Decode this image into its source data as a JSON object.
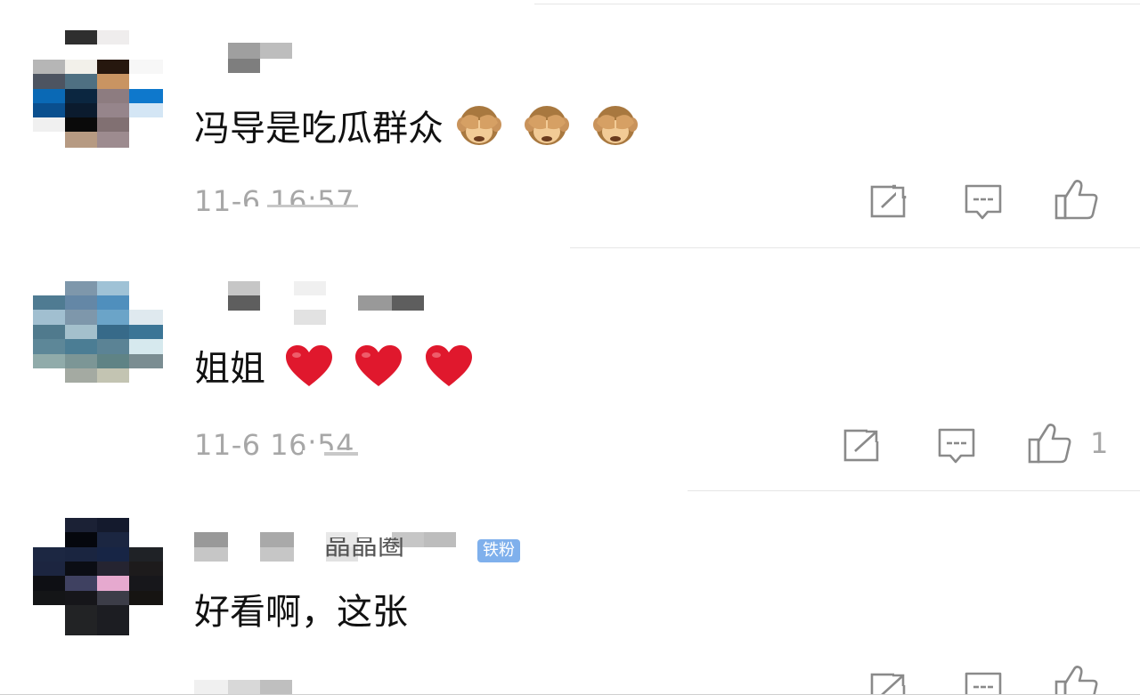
{
  "colors": {
    "text": "#111111",
    "meta": "#a7a7a7",
    "divider": "#e6e6e6",
    "badge": "#7fb0ec",
    "heart": "#e0182d"
  },
  "comments": [
    {
      "text": "冯导是吃瓜群众",
      "emojis": [
        "see-no-evil-monkey",
        "see-no-evil-monkey",
        "see-no-evil-monkey"
      ],
      "timestamp": "11-6 16:57",
      "actions": {
        "share_icon": "share-icon",
        "reply_icon": "comment-icon",
        "like_icon": "thumbs-up-icon",
        "like_count": ""
      }
    },
    {
      "text": "姐姐",
      "emojis": [
        "red-heart",
        "red-heart",
        "red-heart"
      ],
      "timestamp": "11-6 16:54",
      "actions": {
        "share_icon": "share-icon",
        "reply_icon": "comment-icon",
        "like_icon": "thumbs-up-icon",
        "like_count": "1"
      }
    },
    {
      "text": "好看啊，这张",
      "username_visible_part": "晶晶圈",
      "badge": "铁粉",
      "emojis": [],
      "timestamp": "",
      "actions": {
        "share_icon": "share-icon",
        "reply_icon": "comment-icon",
        "like_icon": "thumbs-up-icon",
        "like_count": ""
      }
    }
  ]
}
